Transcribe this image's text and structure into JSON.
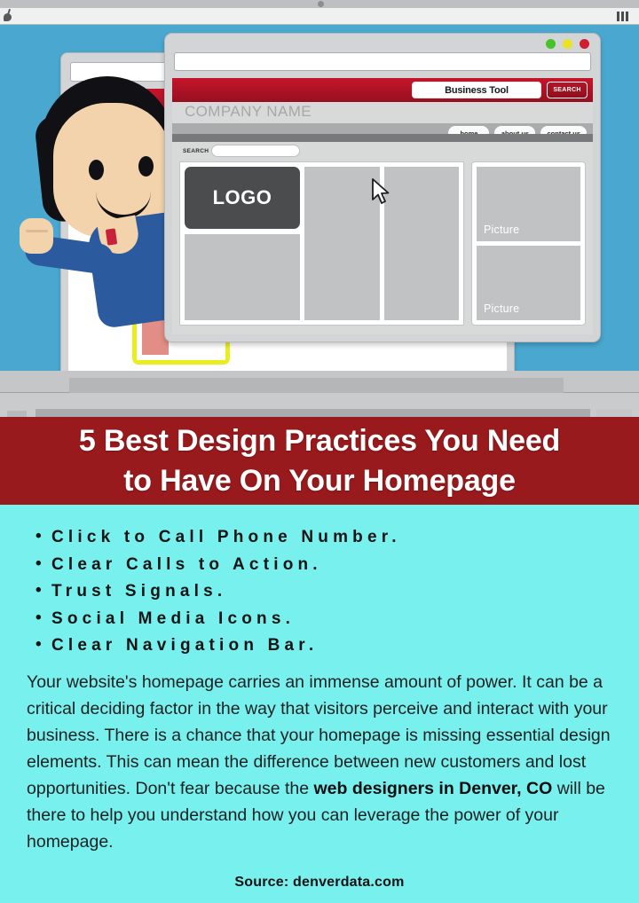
{
  "hero": {
    "os_bar": {
      "left_icon": "pin-icon",
      "right_icon": "menu-bars-icon"
    },
    "window_back": {
      "address_bar_value": "",
      "name": "background-browser-window"
    },
    "window_front": {
      "address_bar_value": "",
      "traffic_lights": [
        "green",
        "yellow",
        "red"
      ],
      "search_box_value": "Business Tool",
      "search_button_label": "SEARCH",
      "company_name": "COMPANY NAME",
      "nav_items": [
        "home",
        "about us",
        "contact us"
      ],
      "search_label": "SEARCH",
      "search_field_value": "",
      "logo_label": "LOGO",
      "picture_labels": [
        "Picture",
        "Picture"
      ]
    },
    "mascot": {
      "name": "businessman-mascot"
    },
    "cursor": {
      "name": "mouse-cursor"
    }
  },
  "title": {
    "line1": "5 Best Design Practices You Need",
    "line2": "to Have On Your Homepage",
    "full": "5 Best Design Practices You Need to Have On Your Homepage"
  },
  "bullets": [
    "Click to Call Phone Number.",
    "Clear Calls to Action.",
    "Trust Signals.",
    "Social Media Icons.",
    "Clear Navigation Bar."
  ],
  "paragraph": {
    "part1": "Your website's homepage carries an immense amount of power. It can be a critical deciding factor in the way that visitors perceive and interact with your business. There is a chance that your homepage is missing essential design elements. This can mean the difference between new customers and lost opportunities. Don't fear because the ",
    "highlight": "web designers in Denver, CO",
    "part2": " will be there to help you understand how you can leverage the power of your homepage."
  },
  "source": "Source: denverdata.com",
  "colors": {
    "title_band": "#991a1c",
    "content_background": "#77f0ee",
    "desktop_blue": "#4aa8d0",
    "accent_red": "#c5152b",
    "logo_dark": "#4a4c4d"
  }
}
